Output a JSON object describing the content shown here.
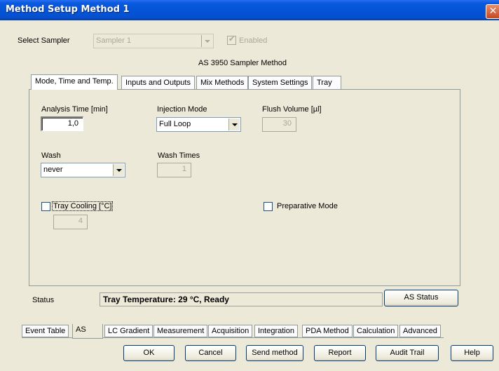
{
  "window": {
    "title": "Method Setup Method 1",
    "close_glyph": "✕"
  },
  "sampler": {
    "label": "Select Sampler",
    "value": "Sampler 1",
    "enabled_label": "Enabled",
    "enabled_checked": true
  },
  "group_title": "AS 3950 Sampler Method",
  "tabs": [
    {
      "label": "Mode, Time and Temp.",
      "active": true
    },
    {
      "label": "Inputs and Outputs"
    },
    {
      "label": "Mix Methods"
    },
    {
      "label": "System Settings"
    },
    {
      "label": "Tray"
    }
  ],
  "form": {
    "analysis_time_label": "Analysis Time [min]",
    "analysis_time_value": "1,0",
    "injection_mode_label": "Injection Mode",
    "injection_mode_value": "Full Loop",
    "flush_volume_label": "Flush Volume [µl]",
    "flush_volume_value": "30",
    "wash_label": "Wash",
    "wash_value": "never",
    "wash_times_label": "Wash Times",
    "wash_times_value": "1",
    "tray_cooling_label": "Tray Cooling [°C]",
    "tray_cooling_checked": false,
    "tray_cooling_value": "4",
    "preparative_label": "Preparative Mode",
    "preparative_checked": false
  },
  "status": {
    "label": "Status",
    "text": "Tray Temperature: 29 °C, Ready",
    "button": "AS Status"
  },
  "bottom_tabs": [
    {
      "label": "Event Table"
    },
    {
      "label": "AS",
      "active": true
    },
    {
      "label": "LC Gradient"
    },
    {
      "label": "Measurement"
    },
    {
      "label": "Acquisition"
    },
    {
      "label": "Integration"
    },
    {
      "label": "PDA Method"
    },
    {
      "label": "Calculation"
    },
    {
      "label": "Advanced"
    }
  ],
  "buttons": {
    "ok": "OK",
    "cancel": "Cancel",
    "send_method": "Send method",
    "report": "Report",
    "audit_trail": "Audit Trail",
    "help": "Help"
  }
}
